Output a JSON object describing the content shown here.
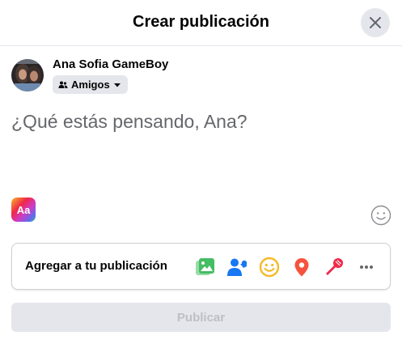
{
  "header": {
    "title": "Crear publicación",
    "close_icon": "close-icon"
  },
  "user": {
    "name": "Ana Sofia GameBoy",
    "avatar": "avatar-photo"
  },
  "audience": {
    "label": "Amigos",
    "icon": "friends-icon",
    "dropdown_icon": "caret-down-icon"
  },
  "composer": {
    "placeholder": "¿Qué estás pensando, Ana?"
  },
  "text_style": {
    "label": "Aa"
  },
  "add_to_post": {
    "label": "Agregar a tu publicación",
    "icons": [
      "photo-video-icon",
      "tag-people-icon",
      "feeling-icon",
      "check-in-icon",
      "live-video-icon",
      "more-icon"
    ]
  },
  "publish": {
    "label": "Publicar",
    "disabled": true
  },
  "colors": {
    "photo": "#45bd62",
    "tag": "#1877f2",
    "feeling": "#f7b928",
    "checkin": "#f5533d",
    "live": "#f02849",
    "more": "#65676b"
  }
}
